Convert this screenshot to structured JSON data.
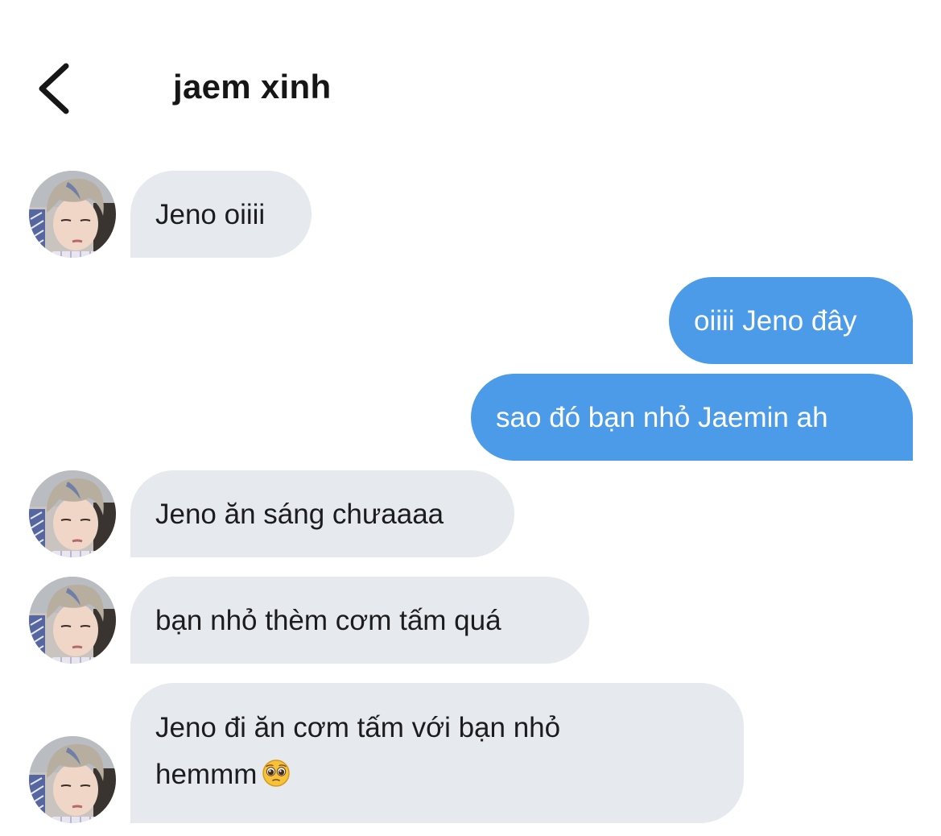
{
  "header": {
    "title": "jaem xinh",
    "back_icon": "chevron-left-icon"
  },
  "colors": {
    "incoming_bubble": "#e6e9ed",
    "outgoing_bubble": "#4b9be8",
    "outgoing_text": "#ffffff",
    "text": "#1c1c1e"
  },
  "messages": [
    {
      "sender": "jaem xinh",
      "direction": "incoming",
      "text": "Jeno oiiii"
    },
    {
      "sender": "me",
      "direction": "outgoing",
      "text": "oiiii Jeno đây"
    },
    {
      "sender": "me",
      "direction": "outgoing",
      "text": "sao đó bạn nhỏ Jaemin ah"
    },
    {
      "sender": "jaem xinh",
      "direction": "incoming",
      "text": "Jeno ăn sáng chưaaaa"
    },
    {
      "sender": "jaem xinh",
      "direction": "incoming",
      "text": "bạn nhỏ thèm cơm tấm quá"
    },
    {
      "sender": "jaem xinh",
      "direction": "incoming",
      "line1": "Jeno đi ăn cơm tấm với bạn nhỏ",
      "line2": "hemmm",
      "emoji": "pleading-face-emoji"
    }
  ]
}
